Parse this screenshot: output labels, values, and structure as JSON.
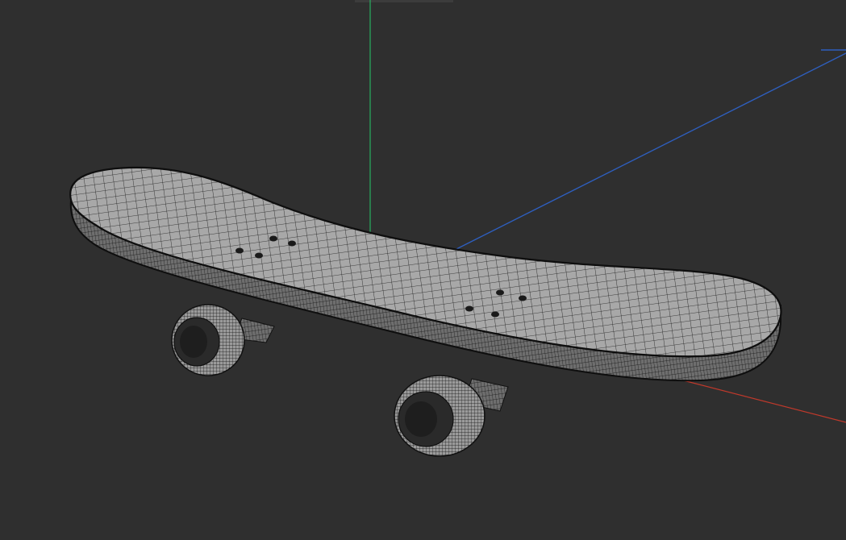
{
  "viewport": {
    "background": "#2f2f2f",
    "axis_colors": {
      "x": "#c0392b",
      "y": "#27ae60",
      "z": "#2e5fbf"
    },
    "model": {
      "name": "skateboard",
      "display_mode": "wireframe-on-shaded",
      "surface_color": "#a9a9a9",
      "wire_color": "#111111"
    }
  }
}
